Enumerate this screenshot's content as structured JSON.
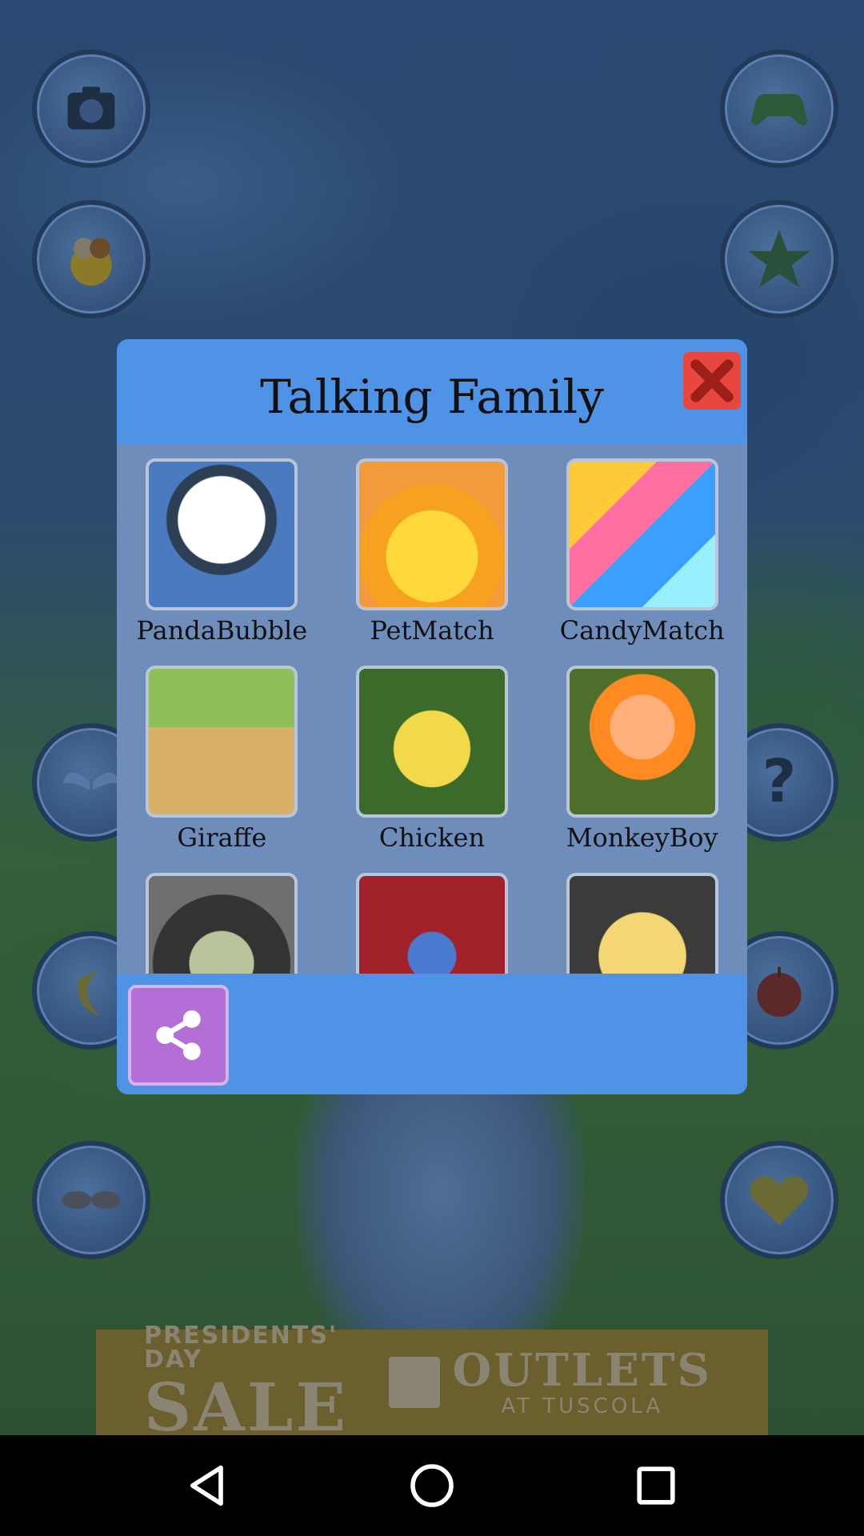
{
  "dialog": {
    "title": "Talking Family",
    "close_icon": "close-icon",
    "share_icon": "share-icon"
  },
  "apps": [
    {
      "label": "PandaBubble"
    },
    {
      "label": "PetMatch"
    },
    {
      "label": "CandyMatch"
    },
    {
      "label": "Giraffe"
    },
    {
      "label": "Chicken"
    },
    {
      "label": "MonkeyBoy"
    },
    {
      "label": ""
    },
    {
      "label": ""
    },
    {
      "label": ""
    }
  ],
  "ad": {
    "line1": "PRESIDENTS' DAY",
    "line2": "SALE",
    "brand1": "OUTLETS",
    "brand2": "AT TUSCOLA"
  },
  "colors": {
    "dialog_blue": "#4f93e6",
    "grid_bg": "#6e8dbb",
    "close_red": "#e8473f",
    "share_purple": "#b36fd6"
  }
}
